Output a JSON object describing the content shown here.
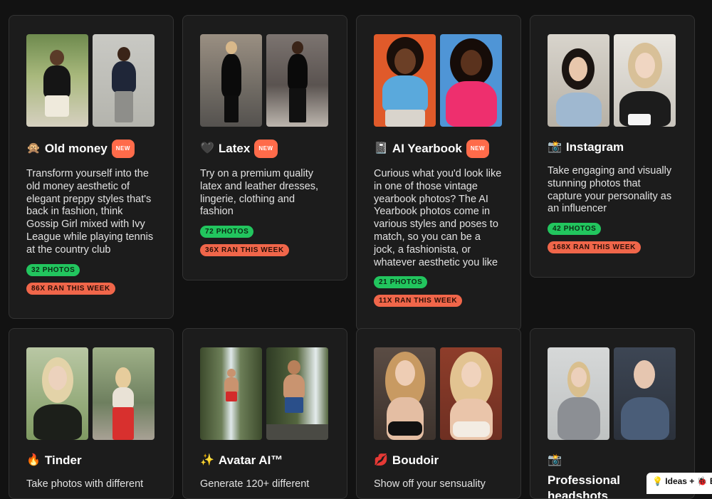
{
  "cards": [
    {
      "emoji": "🙊",
      "title": "Old money",
      "new": "NEW",
      "desc": "Transform yourself into the old money aesthetic of elegant preppy styles that's back in fashion, think Gossip Girl mixed with Ivy League while playing tennis at the country club",
      "photos": "32 PHOTOS",
      "ran": "86X RAN THIS WEEK"
    },
    {
      "emoji": "🖤",
      "title": "Latex",
      "new": "NEW",
      "desc": "Try on a premium quality latex and leather dresses, lingerie, clothing and fashion",
      "photos": "72 PHOTOS",
      "ran": "36X RAN THIS WEEK"
    },
    {
      "emoji": "📓",
      "title": "AI Yearbook",
      "new": "NEW",
      "desc": "Curious what you'd look like in one of those vintage yearbook photos? The AI Yearbook photos come in various styles and poses to match, so you can be a jock, a fashionista, or whatever aesthetic you like",
      "photos": "21 PHOTOS",
      "ran": "11X RAN THIS WEEK"
    },
    {
      "emoji": "📸",
      "title": "Instagram",
      "new": "",
      "desc": "Take engaging and visually stunning photos that capture your personality as an influencer",
      "photos": "42 PHOTOS",
      "ran": "168X RAN THIS WEEK"
    },
    {
      "emoji": "🔥",
      "title": "Tinder",
      "new": "",
      "desc": "Take photos with different",
      "photos": "",
      "ran": ""
    },
    {
      "emoji": "✨",
      "title": "Avatar AI™",
      "new": "",
      "desc": "Generate 120+ different",
      "photos": "",
      "ran": ""
    },
    {
      "emoji": "💋",
      "title": "Boudoir",
      "new": "",
      "desc": "Show off your sensuality",
      "photos": "",
      "ran": ""
    },
    {
      "emoji": "📸",
      "title": "Professional headshots",
      "new": "",
      "desc": "",
      "photos": "",
      "ran": ""
    }
  ],
  "feedback": {
    "label": "💡 Ideas + 🐞 Bugs"
  },
  "colors": {
    "photos": "#22c55e",
    "ran": "#f0664a",
    "new": "#ff6b4a",
    "background": "#121212",
    "card": "#1c1c1c"
  }
}
